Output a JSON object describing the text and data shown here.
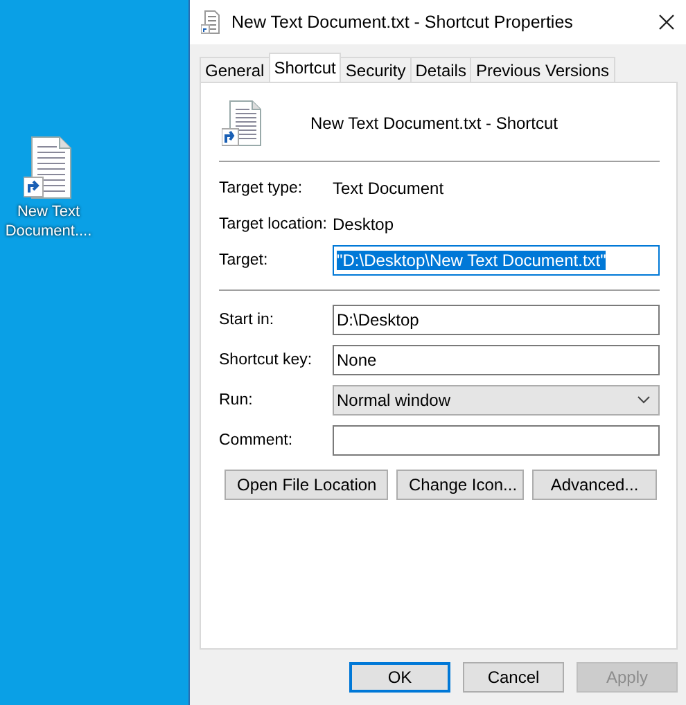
{
  "desktop_icon": {
    "label": "New Text Document...."
  },
  "window": {
    "title": "New Text Document.txt - Shortcut Properties"
  },
  "tabs": [
    {
      "label": "General",
      "selected": false
    },
    {
      "label": "Shortcut",
      "selected": true
    },
    {
      "label": "Security",
      "selected": false
    },
    {
      "label": "Details",
      "selected": false
    },
    {
      "label": "Previous Versions",
      "selected": false
    }
  ],
  "header": {
    "name": "New Text Document.txt - Shortcut"
  },
  "info": [
    {
      "label": "Target type:",
      "value": "Text Document"
    },
    {
      "label": "Target location:",
      "value": "Desktop"
    }
  ],
  "target": {
    "label": "Target:",
    "value": "\"D:\\Desktop\\New Text Document.txt\"",
    "highlighted": true
  },
  "fields": [
    {
      "kind": "text",
      "label": "Start in:",
      "value": "D:\\Desktop"
    },
    {
      "kind": "text",
      "label": "Shortcut key:",
      "value": "None"
    },
    {
      "kind": "dropdown",
      "label": "Run:",
      "value": "Normal window"
    },
    {
      "kind": "text",
      "label": "Comment:"
    }
  ],
  "panel_buttons": [
    "Open File Location",
    "Change Icon...",
    "Advanced..."
  ],
  "buttons": [
    {
      "label": "OK",
      "default": true,
      "disabled": false
    },
    {
      "label": "Cancel",
      "default": false,
      "disabled": false
    },
    {
      "label": "Apply",
      "default": false,
      "disabled": true
    }
  ]
}
